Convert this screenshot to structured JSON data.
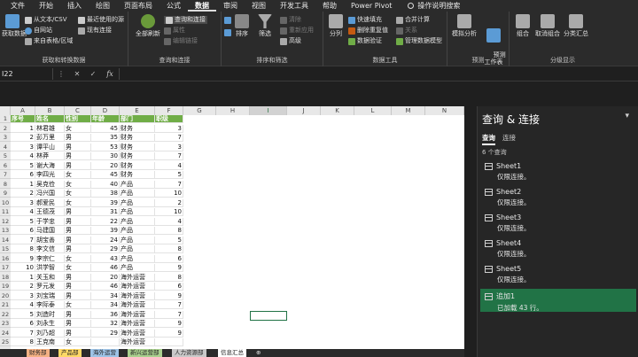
{
  "menu": [
    "文件",
    "开始",
    "插入",
    "绘图",
    "页面布局",
    "公式",
    "数据",
    "审阅",
    "视图",
    "开发工具",
    "帮助",
    "Power Pivot"
  ],
  "menu_active": "数据",
  "search_label": "操作说明搜索",
  "ribbon": {
    "get_data": "获取数据",
    "from_text": "从文本/CSV",
    "from_web": "自网站",
    "from_table": "来自表格/区域",
    "recent": "最近使用的源",
    "existing": "现有连接",
    "group1": "获取和转换数据",
    "refresh_all": "全部刷新",
    "queries_conn": "查询和连接",
    "properties": "属性",
    "edit_links": "编辑链接",
    "group2": "查询和连接",
    "sort": "排序",
    "filter": "筛选",
    "clear": "清除",
    "reapply": "重新应用",
    "advanced": "高级",
    "group3": "排序和筛选",
    "split": "分列",
    "flash_fill": "快速填充",
    "remove_dup": "删除重复值",
    "validation": "数据验证",
    "consolidate": "合并计算",
    "relations": "关系",
    "data_model": "管理数据模型",
    "group4": "数据工具",
    "what_if": "模拟分析",
    "forecast": "预测\n工作表",
    "group5": "预测",
    "group": "组合",
    "ungroup": "取消组合",
    "subtotal": "分类汇总",
    "group6": "分级显示"
  },
  "namebox": "I22",
  "fx": "fx",
  "columns": [
    "A",
    "B",
    "C",
    "D",
    "E",
    "F",
    "G",
    "H",
    "I",
    "J",
    "K",
    "L",
    "M",
    "N"
  ],
  "table_headers": [
    "序号",
    "姓名",
    "性别",
    "年龄",
    "部门",
    "职级"
  ],
  "rows": [
    [
      "1",
      "林君雄",
      "女",
      "45",
      "财务",
      "3"
    ],
    [
      "2",
      "彭万里",
      "男",
      "35",
      "财务",
      "7"
    ],
    [
      "3",
      "谭平山",
      "男",
      "53",
      "财务",
      "3"
    ],
    [
      "4",
      "林莽",
      "男",
      "30",
      "财务",
      "7"
    ],
    [
      "5",
      "谢大海",
      "男",
      "20",
      "财务",
      "4"
    ],
    [
      "6",
      "李四光",
      "女",
      "45",
      "财务",
      "5"
    ],
    [
      "1",
      "吴克俭",
      "女",
      "40",
      "产品",
      "7"
    ],
    [
      "2",
      "冯兴国",
      "女",
      "38",
      "产品",
      "10"
    ],
    [
      "3",
      "郝爱民",
      "女",
      "39",
      "产品",
      "2"
    ],
    [
      "4",
      "王德茂",
      "男",
      "31",
      "产品",
      "10"
    ],
    [
      "5",
      "于学忠",
      "男",
      "22",
      "产品",
      "4"
    ],
    [
      "6",
      "马建国",
      "男",
      "39",
      "产品",
      "8"
    ],
    [
      "7",
      "胡宝善",
      "男",
      "24",
      "产品",
      "5"
    ],
    [
      "8",
      "李文信",
      "男",
      "29",
      "产品",
      "8"
    ],
    [
      "9",
      "李宗仁",
      "女",
      "43",
      "产品",
      "6"
    ],
    [
      "10",
      "洪学智",
      "女",
      "46",
      "产品",
      "9"
    ],
    [
      "1",
      "关玉和",
      "男",
      "20",
      "海外运营",
      "8"
    ],
    [
      "2",
      "罗元发",
      "男",
      "46",
      "海外运营",
      "6"
    ],
    [
      "3",
      "刘宝瑞",
      "男",
      "34",
      "海外运营",
      "9"
    ],
    [
      "4",
      "李际泰",
      "女",
      "34",
      "海外运营",
      "7"
    ],
    [
      "5",
      "刘造时",
      "男",
      "36",
      "海外运营",
      "7"
    ],
    [
      "6",
      "刘永生",
      "男",
      "32",
      "海外运营",
      "9"
    ],
    [
      "7",
      "刘乃超",
      "男",
      "29",
      "海外运营",
      "9"
    ],
    [
      "8",
      "王克南",
      "女",
      "",
      "海外运营",
      ""
    ]
  ],
  "row_numbers": [
    "1",
    "2",
    "3",
    "4",
    "5",
    "6",
    "7",
    "8",
    "9",
    "10",
    "11",
    "12",
    "13",
    "14",
    "15",
    "16",
    "17",
    "18",
    "19",
    "20",
    "21",
    "22",
    "23",
    "24",
    "25"
  ],
  "tabs": [
    "财务部",
    "产品部",
    "海外运营",
    "新兴运营部",
    "人力资源部",
    "信息汇总"
  ],
  "pane": {
    "title": "查询 & 连接",
    "tab_queries": "查询",
    "tab_connections": "连接",
    "count": "6 个查询",
    "items": [
      {
        "name": "Sheet1",
        "status": "仅限连接。"
      },
      {
        "name": "Sheet2",
        "status": "仅限连接。"
      },
      {
        "name": "Sheet3",
        "status": "仅限连接。"
      },
      {
        "name": "Sheet4",
        "status": "仅限连接。"
      },
      {
        "name": "Sheet5",
        "status": "仅限连接。"
      },
      {
        "name": "追加1",
        "status": "已加载 43 行。"
      }
    ]
  },
  "colors": {
    "accent": "#217346",
    "header_green": "#70ad47",
    "tab_orange": "#f4b183",
    "tab_green": "#a9d08e",
    "tab_yellow": "#ffd966"
  }
}
